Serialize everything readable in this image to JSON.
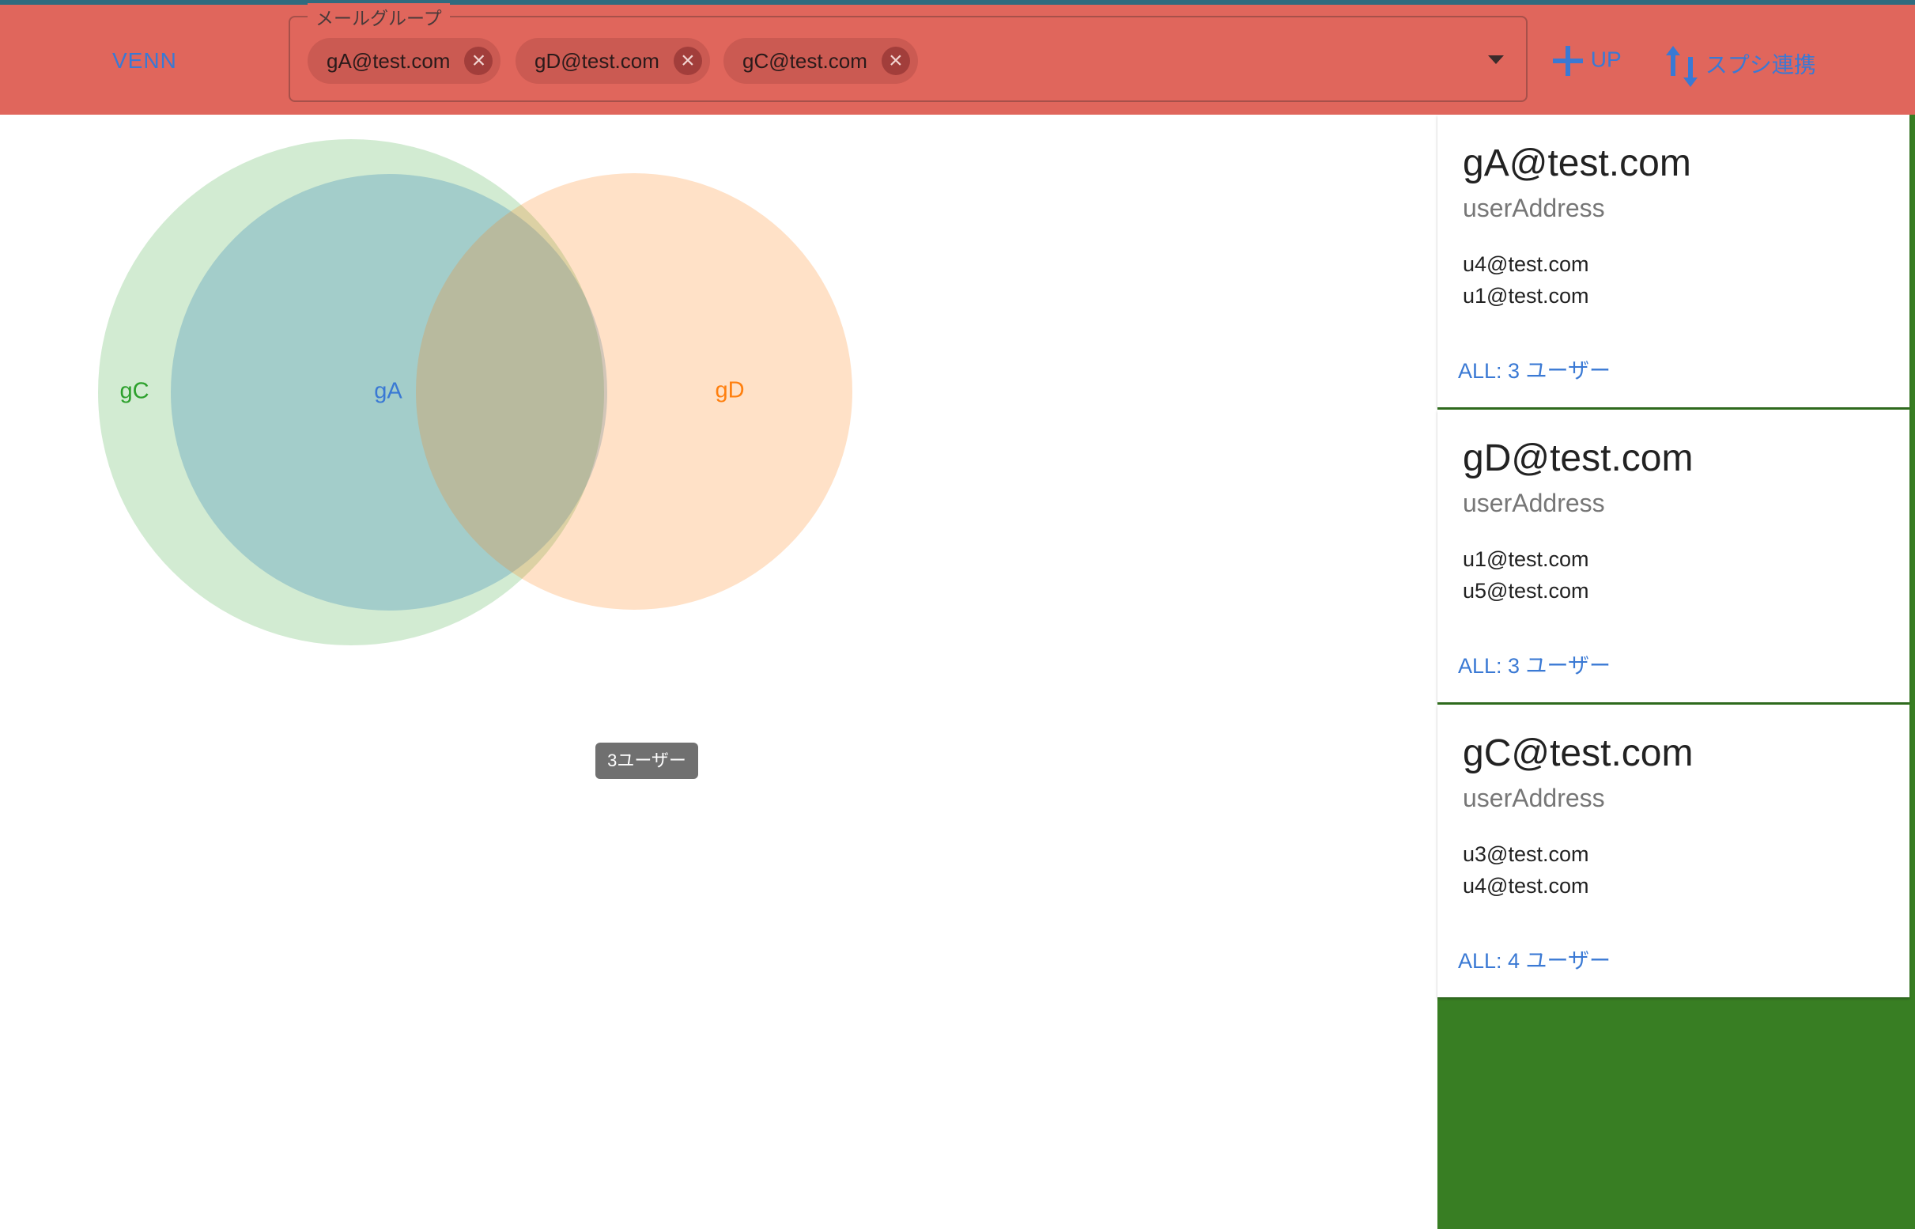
{
  "header": {
    "venn_tab": "VENN",
    "select_legend": "メールグループ",
    "chips": [
      {
        "label": "gA@test.com"
      },
      {
        "label": "gD@test.com"
      },
      {
        "label": "gC@test.com"
      }
    ],
    "chip_remove_icon": "×",
    "up_button": "UP",
    "sheet_button": "スプシ連携",
    "icons": {
      "add": "plus-icon",
      "sync": "swap-vertical-icon",
      "remove": "close-circle-icon",
      "dropdown": "arrow-drop-down-icon"
    }
  },
  "venn": {
    "sets": [
      {
        "name": "gC",
        "color": "#2ca02c"
      },
      {
        "name": "gA",
        "color": "#1f77b4"
      },
      {
        "name": "gD",
        "color": "#ff7f0e"
      }
    ],
    "tooltip": "3ユーザー"
  },
  "cards": [
    {
      "title": "gA@test.com",
      "subtitle": "userAddress",
      "users": [
        "u4@test.com",
        "u1@test.com"
      ],
      "all": "ALL: 3 ユーザー"
    },
    {
      "title": "gD@test.com",
      "subtitle": "userAddress",
      "users": [
        "u1@test.com",
        "u5@test.com"
      ],
      "all": "ALL: 3 ユーザー"
    },
    {
      "title": "gC@test.com",
      "subtitle": "userAddress",
      "users": [
        "u3@test.com",
        "u4@test.com"
      ],
      "all": "ALL: 4 ユーザー"
    }
  ],
  "colors": {
    "appbar": "#e0665c",
    "accent": "#3a79d4",
    "side_panel": "#387e23"
  }
}
